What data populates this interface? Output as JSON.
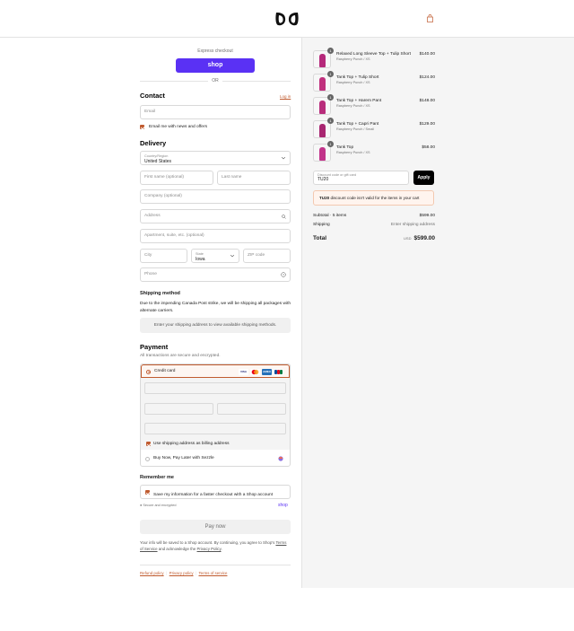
{
  "header": {
    "logo": "logo-icon",
    "cart": "bag-icon"
  },
  "express": {
    "label": "Express checkout",
    "shop_button": "shop",
    "or": "OR"
  },
  "contact": {
    "title": "Contact",
    "login": "Log in",
    "email_placeholder": "Email",
    "newsletter_label": "Email me with news and offers",
    "newsletter_checked": true
  },
  "delivery": {
    "title": "Delivery",
    "country_label": "Country/Region",
    "country_value": "United States",
    "first_name": "First name (optional)",
    "last_name": "Last name",
    "company": "Company (optional)",
    "address": "Address",
    "apartment": "Apartment, suite, etc. (optional)",
    "city": "City",
    "state_label": "State",
    "state_value": "Iowa",
    "zip": "ZIP code",
    "phone": "Phone"
  },
  "shipping": {
    "title": "Shipping method",
    "notice": "Due to the impending Canada Post strike, we will be shipping all packages with alternate carriers.",
    "placeholder": "Enter your shipping address to view available shipping methods."
  },
  "payment": {
    "title": "Payment",
    "subtitle": "All transactions are secure and encrypted.",
    "credit_card": "Credit card",
    "cards": [
      "VISA",
      "MC",
      "AMEX",
      "JCB"
    ],
    "billing_label": "Use shipping address as billing address",
    "sezzle_label": "Buy Now, Pay Later with Sezzle"
  },
  "remember": {
    "title": "Remember me",
    "save_label": "Save my information for a faster checkout with a Shop account",
    "secure": "Secure and encrypted",
    "shop": "shop"
  },
  "pay_now": "Pay now",
  "legal": {
    "prefix": "Your info will be saved to a Shop account. By continuing, you agree to Shop's",
    "terms": "Terms of Service",
    "middle": "and acknowledge the",
    "privacy": "Privacy Policy",
    "end": "."
  },
  "footer_links": [
    "Refund policy",
    "Privacy policy",
    "Terms of service"
  ],
  "order": {
    "items": [
      {
        "qty": "1",
        "name": "Relaxed Long Sleeve Top + Tulip Short",
        "variant": "Raspberry Punch / XS",
        "price": "$140.00",
        "color": "#b5287a"
      },
      {
        "qty": "1",
        "name": "Tank Top + Tulip Short",
        "variant": "Raspberry Punch / XS",
        "price": "$124.00",
        "color": "#c0307d"
      },
      {
        "qty": "1",
        "name": "Tank Top + Harem Pant",
        "variant": "Raspberry Punch / XS",
        "price": "$148.00",
        "color": "#b82c7b"
      },
      {
        "qty": "1",
        "name": "Tank Top + Capri Pant",
        "variant": "Raspberry Punch / Small",
        "price": "$129.00",
        "color": "#a82570"
      },
      {
        "qty": "1",
        "name": "Tank Top",
        "variant": "Raspberry Punch / XS",
        "price": "$58.00",
        "color": "#c2338a"
      }
    ],
    "discount_label": "Discount code or gift card",
    "discount_value": "TU20",
    "apply": "Apply",
    "alert_code": "TU20",
    "alert_text": "discount code isn't valid for the items in your cart",
    "subtotal_label": "Subtotal · 5 items",
    "subtotal_value": "$599.00",
    "shipping_label": "Shipping",
    "shipping_value": "Enter shipping address",
    "total_label": "Total",
    "currency": "USD",
    "total_value": "$599.00"
  },
  "colors": {
    "accent": "#c05b2f",
    "shop_purple": "#5a31f4"
  }
}
